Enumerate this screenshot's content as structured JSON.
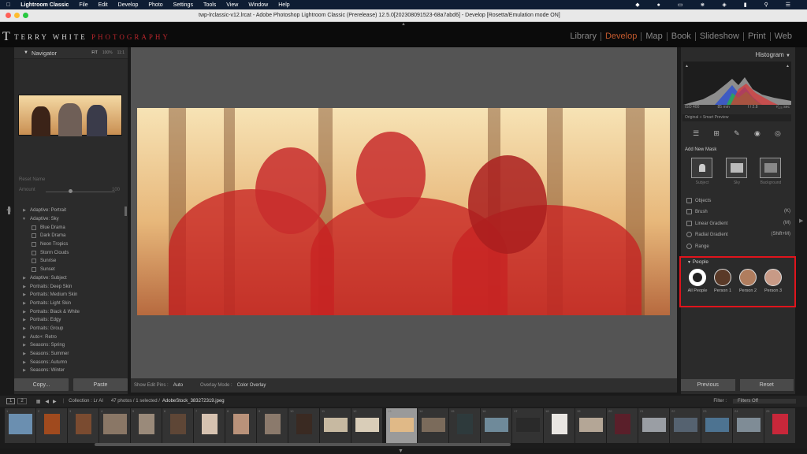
{
  "menubar": {
    "app": "Lightroom Classic",
    "items": [
      "File",
      "Edit",
      "Develop",
      "Photo",
      "Settings",
      "Tools",
      "View",
      "Window",
      "Help"
    ]
  },
  "window": {
    "title": "twp-lrclassic-v12.lrcat - Adobe Photoshop Lightroom Classic (Prerelease) 12.5.0[202308091523-68a7abd6] - Develop [Rosetta/Emulation mode ON]"
  },
  "identity": {
    "name": "Terry White",
    "photography": "Photography"
  },
  "modules": [
    "Library",
    "Develop",
    "Map",
    "Book",
    "Slideshow",
    "Print",
    "Web"
  ],
  "active_module": "Develop",
  "left_panel": {
    "navigator_label": "Navigator",
    "zoom_options": [
      "FIT",
      "100%",
      "11:1"
    ],
    "reset_label": "Reset Name",
    "amount_label": "Amount",
    "amount_value": "100",
    "presets": [
      {
        "label": "Adaptive: Portrait",
        "type": "folder",
        "open": false
      },
      {
        "label": "Adaptive: Sky",
        "type": "folder",
        "open": true
      },
      {
        "label": "Blue Drama",
        "type": "preset"
      },
      {
        "label": "Dark Drama",
        "type": "preset"
      },
      {
        "label": "Neon Tropics",
        "type": "preset"
      },
      {
        "label": "Storm Clouds",
        "type": "preset"
      },
      {
        "label": "Sunrise",
        "type": "preset"
      },
      {
        "label": "Sunset",
        "type": "preset"
      },
      {
        "label": "Adaptive: Subject",
        "type": "folder",
        "open": false
      },
      {
        "label": "Portraits: Deep Skin",
        "type": "folder",
        "open": false
      },
      {
        "label": "Portraits: Medium Skin",
        "type": "folder",
        "open": false
      },
      {
        "label": "Portraits: Light Skin",
        "type": "folder",
        "open": false
      },
      {
        "label": "Portraits: Black & White",
        "type": "folder",
        "open": false
      },
      {
        "label": "Portraits: Edgy",
        "type": "folder",
        "open": false
      },
      {
        "label": "Portraits: Group",
        "type": "folder",
        "open": false
      },
      {
        "label": "Auto+: Retro",
        "type": "folder",
        "open": false
      },
      {
        "label": "Seasons: Spring",
        "type": "folder",
        "open": false
      },
      {
        "label": "Seasons: Summer",
        "type": "folder",
        "open": false
      },
      {
        "label": "Seasons: Autumn",
        "type": "folder",
        "open": false
      },
      {
        "label": "Seasons: Winter",
        "type": "folder",
        "open": false
      }
    ],
    "copy_button": "Copy...",
    "paste_button": "Paste"
  },
  "toolbar": {
    "edit_pins_label": "Show Edit Pins :",
    "edit_pins_value": "Auto",
    "overlay_label": "Overlay Mode :",
    "overlay_value": "Color Overlay"
  },
  "right_panel": {
    "histogram_label": "Histogram",
    "iso": "ISO 400",
    "focal": "85 mm",
    "aperture": "f / 2.8",
    "shutter": "¹⁄₁₂₅ sec",
    "smart_preview": "Original + Smart Preview",
    "add_new_mask": "Add New Mask",
    "mask_tiles": [
      "Subject",
      "Sky",
      "Background"
    ],
    "mask_rows": [
      {
        "label": "Objects",
        "shortcut": ""
      },
      {
        "label": "Brush",
        "shortcut": "(K)"
      },
      {
        "label": "Linear Gradient",
        "shortcut": "(M)"
      },
      {
        "label": "Radial Gradient",
        "shortcut": "(Shift+M)"
      },
      {
        "label": "Range",
        "shortcut": ""
      }
    ],
    "people_label": "People",
    "people": [
      "All People",
      "Person 1",
      "Person 2",
      "Person 3"
    ],
    "previous_button": "Previous",
    "reset_button": "Reset"
  },
  "filmstrip": {
    "page_buttons": [
      "1",
      "2"
    ],
    "collection": "Collection : Lr AI",
    "count": "47 photos / 1 selected /",
    "filename": "AdobeStock_383272319.jpeg",
    "filter_label": "Filter :",
    "filter_value": "Filters Off",
    "cell_numbers": [
      "1",
      "2",
      "3",
      "4",
      "5",
      "6",
      "7",
      "8",
      "9",
      "10",
      "11",
      "12",
      "13",
      "14",
      "15",
      "16",
      "17",
      "18",
      "19",
      "20",
      "21",
      "22",
      "23",
      "24",
      "25"
    ]
  },
  "colors": {
    "accent": "#c35a2e",
    "highlight_box": "#e0141c",
    "mask_overlay": "#c82323"
  }
}
